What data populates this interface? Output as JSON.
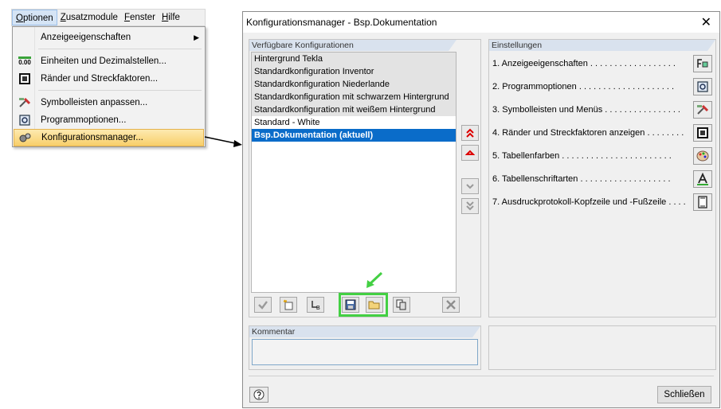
{
  "menubar": {
    "items": [
      {
        "underline": "O",
        "rest": "ptionen"
      },
      {
        "underline": "Z",
        "rest": "usatzmodule"
      },
      {
        "underline": "F",
        "rest": "enster"
      },
      {
        "underline": "H",
        "rest": "ilfe"
      }
    ]
  },
  "dropdown": {
    "items": [
      {
        "label": "Anzeigeeigenschaften",
        "icon": "display-properties-icon",
        "submenu": "▶"
      },
      {
        "label": "Einheiten und Dezimalstellen...",
        "icon": "units-icon",
        "icon_text": "0.00"
      },
      {
        "label": "Ränder und Streckfaktoren...",
        "icon": "margins-icon"
      },
      {
        "label": "Symbolleisten anpassen...",
        "icon": "toolbar-customize-icon"
      },
      {
        "label": "Programmoptionen...",
        "icon": "program-options-icon"
      },
      {
        "label": "Konfigurationsmanager...",
        "icon": "configuration-manager-icon"
      }
    ]
  },
  "dialog": {
    "title": "Konfigurationsmanager - Bsp.Dokumentation",
    "close_glyph": "✕",
    "available_title": "Verfügbare Konfigurationen",
    "configs": [
      {
        "label": "Hintergrund Tekla",
        "style": "gray"
      },
      {
        "label": "Standardkonfiguration Inventor",
        "style": "gray"
      },
      {
        "label": "Standardkonfiguration Niederlande",
        "style": "gray"
      },
      {
        "label": "Standardkonfiguration mit schwarzem Hintergrund",
        "style": "gray"
      },
      {
        "label": "Standardkonfiguration mit weißem Hintergrund",
        "style": "gray"
      },
      {
        "label": "Standard - White",
        "style": "white"
      },
      {
        "label": "Bsp.Dokumentation (aktuell)",
        "style": "sel"
      }
    ],
    "settings_title": "Einstellungen",
    "settings": [
      {
        "label": "1. Anzeigeeigenschaften . . . . . . . . . . . . . . . . . .",
        "icon": "display-properties-icon"
      },
      {
        "label": "2. Programmoptionen . . . . . . . . . . . . . . . . . . . .",
        "icon": "program-options-icon"
      },
      {
        "label": "3. Symbolleisten und Menüs . . . . . . . . . . . . . . . .",
        "icon": "toolbar-icon"
      },
      {
        "label": "4. Ränder und Streckfaktoren anzeigen . . . . . . . .",
        "icon": "margins-icon"
      },
      {
        "label": "5. Tabellenfarben . . . . . . . . . . . . . . . . . . . . . . .",
        "icon": "palette-icon"
      },
      {
        "label": "6. Tabellenschriftarten . . . . . . . . . . . . . . . . . . .",
        "icon": "font-icon"
      },
      {
        "label": "7. Ausdruckprotokoll-Kopfzeile und -Fußzeile . . . .",
        "icon": "page-icon"
      }
    ],
    "comment_title": "Kommentar",
    "comment_value": "",
    "close_label": "Schließen"
  },
  "colors": {
    "selection": "#0a6cc9",
    "highlight_menu": "#f8cf6a",
    "green_annotation": "#43d043",
    "panel_header": "#d9e2ee"
  }
}
